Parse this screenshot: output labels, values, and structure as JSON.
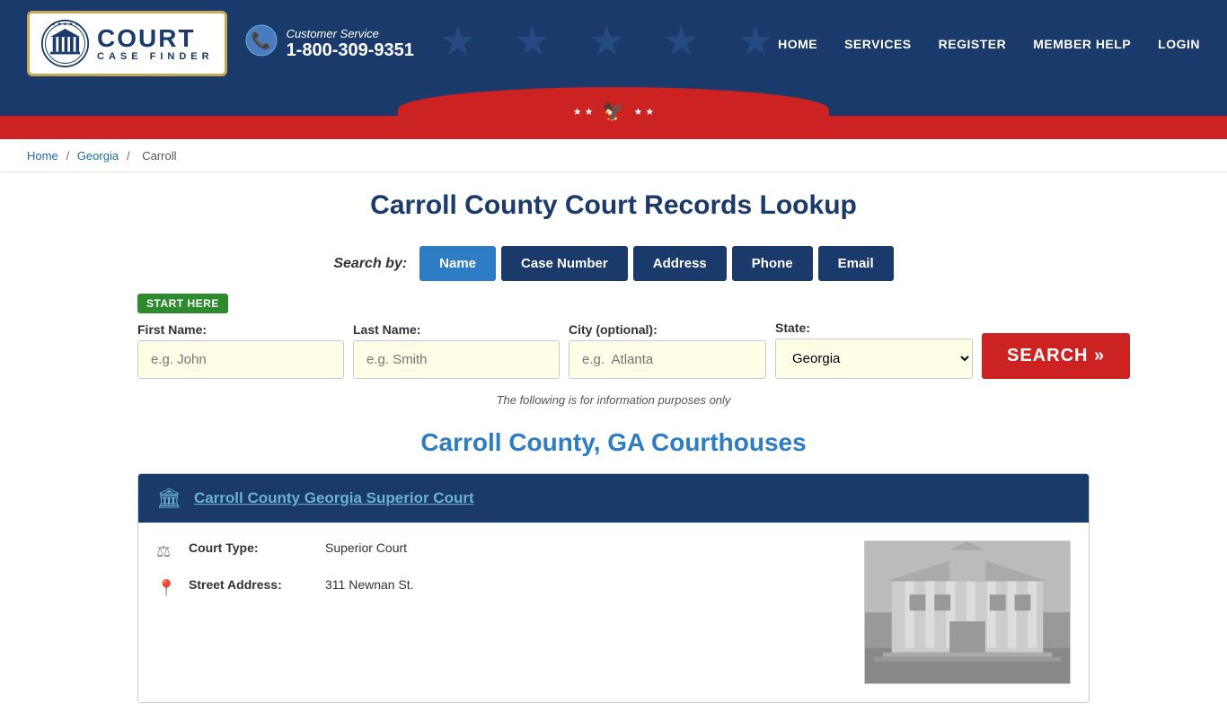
{
  "header": {
    "logo": {
      "court_label": "COURT",
      "case_finder_label": "CASE FINDER"
    },
    "phone": {
      "label": "Customer Service",
      "number": "1-800-309-9351"
    },
    "nav": {
      "items": [
        {
          "label": "HOME",
          "href": "#"
        },
        {
          "label": "SERVICES",
          "href": "#"
        },
        {
          "label": "REGISTER",
          "href": "#"
        },
        {
          "label": "MEMBER HELP",
          "href": "#"
        },
        {
          "label": "LOGIN",
          "href": "#"
        }
      ]
    },
    "wave": {
      "stars": "★ ★",
      "eagle": "🦅",
      "stars2": "★ ★"
    }
  },
  "breadcrumb": {
    "home": "Home",
    "georgia": "Georgia",
    "current": "Carroll"
  },
  "main": {
    "page_title": "Carroll County Court Records Lookup",
    "search_by_label": "Search by:",
    "tabs": [
      {
        "label": "Name",
        "active": true
      },
      {
        "label": "Case Number",
        "active": false
      },
      {
        "label": "Address",
        "active": false
      },
      {
        "label": "Phone",
        "active": false
      },
      {
        "label": "Email",
        "active": false
      }
    ],
    "start_here": "START HERE",
    "form": {
      "first_name_label": "First Name:",
      "first_name_placeholder": "e.g. John",
      "last_name_label": "Last Name:",
      "last_name_placeholder": "e.g. Smith",
      "city_label": "City (optional):",
      "city_placeholder": "e.g.  Atlanta",
      "state_label": "State:",
      "state_value": "Georgia",
      "search_button": "SEARCH »"
    },
    "info_note": "The following is for information purposes only",
    "courthouses_title": "Carroll County, GA Courthouses",
    "courthouse": {
      "name": "Carroll County Georgia Superior Court",
      "name_link": "Carroll County Georgia Superior Court",
      "court_type_label": "Court Type:",
      "court_type_value": "Superior Court",
      "address_label": "Street Address:",
      "address_value": "311 Newnan St."
    }
  }
}
